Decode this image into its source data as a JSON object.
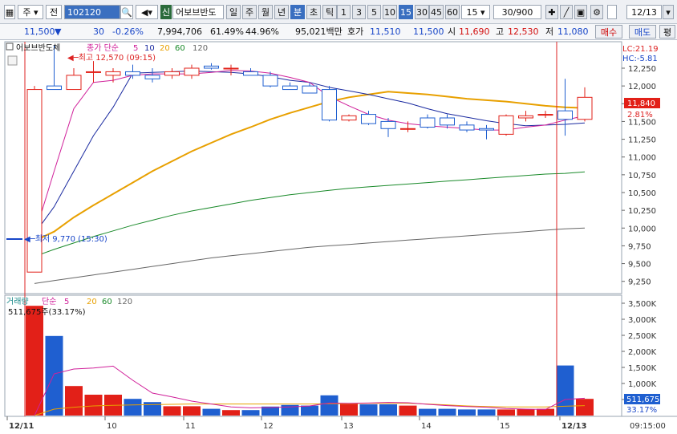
{
  "toolbar": {
    "type_select": "주",
    "market_select": "전",
    "code_input": "102120",
    "stock_badge": "신",
    "stock_name": "어보브반도",
    "period_tabs": [
      "일",
      "주",
      "월",
      "년",
      "분",
      "초",
      "틱"
    ],
    "active_period": "분",
    "interval_buttons": [
      "1",
      "3",
      "5",
      "10",
      "15",
      "30",
      "45",
      "60"
    ],
    "active_interval": "15",
    "interval_select": "15",
    "count_value": "30",
    "count_total": "/900",
    "date_value": "12/13"
  },
  "quote": {
    "price": "11,500",
    "direction": "▼",
    "change": "30",
    "change_pct": "-0.26%",
    "volume": "7,994,706",
    "ratio1": "61.49%",
    "ratio2": "44.96%",
    "amount": "95,021백만",
    "bid_label": "호가",
    "ask_price": "11,510",
    "bid_price": "11,500",
    "open_label": "시",
    "open": "11,690",
    "high_label": "고",
    "high": "12,530",
    "low_label": "저",
    "low": "11,080",
    "buy_label": "매수",
    "sell_label": "매도",
    "extra_label": "평"
  },
  "price_pane": {
    "title": "어보브반도체",
    "ma_label": "종가 단순",
    "ma_periods": [
      "5",
      "10",
      "20",
      "60",
      "120"
    ],
    "lc": "LC:21.19",
    "hc": "HC:-5.81",
    "max_annot": "최고 12,570 (09:15)",
    "min_annot": "최저 9,770 (15:30)",
    "current_price_tag": "11,840",
    "current_pct_tag": "2.81%",
    "y_ticks": [
      "12,250",
      "12,000",
      "11,750",
      "11,500",
      "11,250",
      "11,000",
      "10,750",
      "10,500",
      "10,250",
      "10,000",
      "9,750",
      "9,500",
      "9,250"
    ]
  },
  "volume_pane": {
    "title": "거래량",
    "ma_label": "단순",
    "ma_periods": [
      "5",
      "20",
      "60",
      "120"
    ],
    "annot": "511,675주(33.17%)",
    "current_tag": "511,675",
    "current_pct": "33.17%",
    "y_ticks": [
      "3,500K",
      "3,000K",
      "2,500K",
      "2,000K",
      "1,500K",
      "1,000K",
      "500K"
    ]
  },
  "x_axis": {
    "labels": [
      "12/11",
      "10",
      "11",
      "12",
      "13",
      "14",
      "15",
      "12/13"
    ],
    "time_label": "09:15:00"
  },
  "colors": {
    "up": "#e22018",
    "down": "#1f5fd0",
    "ma5": "#d0209a",
    "ma10": "#1a2aa0",
    "ma20": "#e8a000",
    "ma60": "#1a8a2a",
    "ma120": "#666666"
  },
  "chart_data": {
    "type": "candlestick",
    "candles": [
      {
        "o": 9380,
        "h": 12000,
        "l": 9770,
        "c": 11950
      },
      {
        "o": 12000,
        "h": 12570,
        "l": 11950,
        "c": 11950
      },
      {
        "o": 11950,
        "h": 12250,
        "l": 11950,
        "c": 12150
      },
      {
        "o": 12200,
        "h": 12350,
        "l": 12050,
        "c": 12200
      },
      {
        "o": 12150,
        "h": 12250,
        "l": 12050,
        "c": 12200
      },
      {
        "o": 12200,
        "h": 12300,
        "l": 12100,
        "c": 12150
      },
      {
        "o": 12150,
        "h": 12250,
        "l": 12050,
        "c": 12100
      },
      {
        "o": 12150,
        "h": 12250,
        "l": 12100,
        "c": 12200
      },
      {
        "o": 12150,
        "h": 12300,
        "l": 12100,
        "c": 12250
      },
      {
        "o": 12280,
        "h": 12320,
        "l": 12230,
        "c": 12250
      },
      {
        "o": 12250,
        "h": 12300,
        "l": 12150,
        "c": 12250
      },
      {
        "o": 12200,
        "h": 12250,
        "l": 12150,
        "c": 12150
      },
      {
        "o": 12150,
        "h": 12200,
        "l": 11980,
        "c": 12000
      },
      {
        "o": 12000,
        "h": 12050,
        "l": 11950,
        "c": 11950
      },
      {
        "o": 12000,
        "h": 12050,
        "l": 11900,
        "c": 11900
      },
      {
        "o": 11950,
        "h": 12000,
        "l": 11500,
        "c": 11520
      },
      {
        "o": 11520,
        "h": 11600,
        "l": 11500,
        "c": 11580
      },
      {
        "o": 11600,
        "h": 11650,
        "l": 11450,
        "c": 11470
      },
      {
        "o": 11500,
        "h": 11550,
        "l": 11280,
        "c": 11400
      },
      {
        "o": 11400,
        "h": 11500,
        "l": 11350,
        "c": 11400
      },
      {
        "o": 11550,
        "h": 11600,
        "l": 11400,
        "c": 11420
      },
      {
        "o": 11550,
        "h": 11600,
        "l": 11400,
        "c": 11450
      },
      {
        "o": 11450,
        "h": 11500,
        "l": 11350,
        "c": 11380
      },
      {
        "o": 11400,
        "h": 11450,
        "l": 11250,
        "c": 11380
      },
      {
        "o": 11320,
        "h": 11600,
        "l": 11300,
        "c": 11580
      },
      {
        "o": 11550,
        "h": 11650,
        "l": 11500,
        "c": 11580
      },
      {
        "o": 11600,
        "h": 11650,
        "l": 11550,
        "c": 11600
      },
      {
        "o": 11650,
        "h": 12100,
        "l": 11300,
        "c": 11530
      },
      {
        "o": 11530,
        "h": 11980,
        "l": 11500,
        "c": 11840
      }
    ],
    "volume_k": [
      3420,
      2480,
      920,
      650,
      650,
      520,
      420,
      290,
      290,
      210,
      170,
      170,
      280,
      330,
      310,
      630,
      370,
      350,
      350,
      310,
      210,
      210,
      190,
      190,
      190,
      200,
      210,
      1560,
      520
    ],
    "ma5": [
      9900,
      10800,
      11680,
      12050,
      12080,
      12150,
      12170,
      12170,
      12170,
      12190,
      12220,
      12210,
      12180,
      12120,
      12050,
      11850,
      11720,
      11600,
      11520,
      11470,
      11440,
      11420,
      11400,
      11380,
      11380,
      11420,
      11450,
      11520,
      11580
    ],
    "ma10": [
      9920,
      10300,
      10800,
      11300,
      11700,
      12180,
      12190,
      12200,
      12210,
      12200,
      12190,
      12170,
      12130,
      12080,
      12050,
      11980,
      11930,
      11880,
      11820,
      11760,
      11680,
      11610,
      11560,
      11510,
      11470,
      11440,
      11450,
      11460,
      11480
    ],
    "ma20": [
      9820,
      9950,
      10150,
      10320,
      10480,
      10640,
      10800,
      10940,
      11080,
      11200,
      11320,
      11420,
      11530,
      11620,
      11700,
      11780,
      11840,
      11880,
      11920,
      11900,
      11880,
      11850,
      11820,
      11800,
      11780,
      11750,
      11720,
      11700,
      11690
    ],
    "ma60": [
      9600,
      9700,
      9790,
      9880,
      9960,
      10040,
      10110,
      10180,
      10240,
      10290,
      10340,
      10390,
      10430,
      10470,
      10500,
      10530,
      10560,
      10580,
      10600,
      10620,
      10640,
      10660,
      10680,
      10700,
      10720,
      10740,
      10760,
      10770,
      10790
    ],
    "ma120": [
      9220,
      9260,
      9300,
      9340,
      9380,
      9420,
      9460,
      9500,
      9540,
      9580,
      9610,
      9640,
      9670,
      9700,
      9730,
      9750,
      9770,
      9790,
      9810,
      9830,
      9850,
      9870,
      9890,
      9910,
      9930,
      9950,
      9970,
      9990,
      10000
    ],
    "vol_ma5": [
      0,
      1300,
      1450,
      1480,
      1540,
      1100,
      700,
      580,
      450,
      360,
      270,
      240,
      250,
      270,
      300,
      390,
      380,
      390,
      410,
      400,
      350,
      310,
      280,
      260,
      220,
      200,
      190,
      500,
      540
    ],
    "vol_ma20": [
      0,
      200,
      260,
      300,
      320,
      330,
      340,
      350,
      360,
      360,
      360,
      360,
      360,
      360,
      360,
      370,
      370,
      380,
      380,
      380,
      360,
      330,
      300,
      280,
      270,
      270,
      270,
      290,
      310
    ],
    "y_range": [
      9100,
      12600
    ],
    "vol_range_k": [
      0,
      3700
    ]
  }
}
